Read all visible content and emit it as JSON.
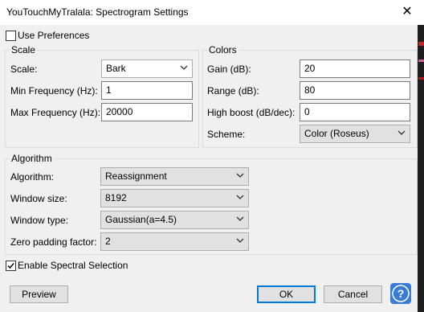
{
  "window": {
    "title": "YouTouchMyTralala: Spectrogram Settings",
    "close_glyph": "✕"
  },
  "use_preferences": {
    "label": "Use Preferences",
    "checked": false
  },
  "scale_group": {
    "legend": "Scale",
    "scale_label": "Scale:",
    "scale_value": "Bark",
    "min_freq_label": "Min Frequency (Hz):",
    "min_freq_value": "1",
    "max_freq_label": "Max Frequency (Hz):",
    "max_freq_value": "20000"
  },
  "colors_group": {
    "legend": "Colors",
    "gain_label": "Gain (dB):",
    "gain_value": "20",
    "range_label": "Range (dB):",
    "range_value": "80",
    "high_boost_label": "High boost (dB/dec):",
    "high_boost_value": "0",
    "scheme_label": "Scheme:",
    "scheme_value": "Color (Roseus)"
  },
  "algorithm_group": {
    "legend": "Algorithm",
    "algorithm_label": "Algorithm:",
    "algorithm_value": "Reassignment",
    "window_size_label": "Window size:",
    "window_size_value": "8192",
    "window_type_label": "Window type:",
    "window_type_value": "Gaussian(a=4.5)",
    "zero_padding_label": "Zero padding factor:",
    "zero_padding_value": "2"
  },
  "spectral_selection": {
    "label": "Enable Spectral Selection",
    "checked": true
  },
  "buttons": {
    "preview": "Preview",
    "ok": "OK",
    "cancel": "Cancel",
    "help_glyph": "?"
  },
  "colors": {
    "accent": "#0078d7",
    "help_bg": "#3a7bd5"
  },
  "icons": {
    "dropdown": "chevron-down-icon",
    "close": "close-icon",
    "help": "help-icon",
    "check": "check-icon"
  }
}
